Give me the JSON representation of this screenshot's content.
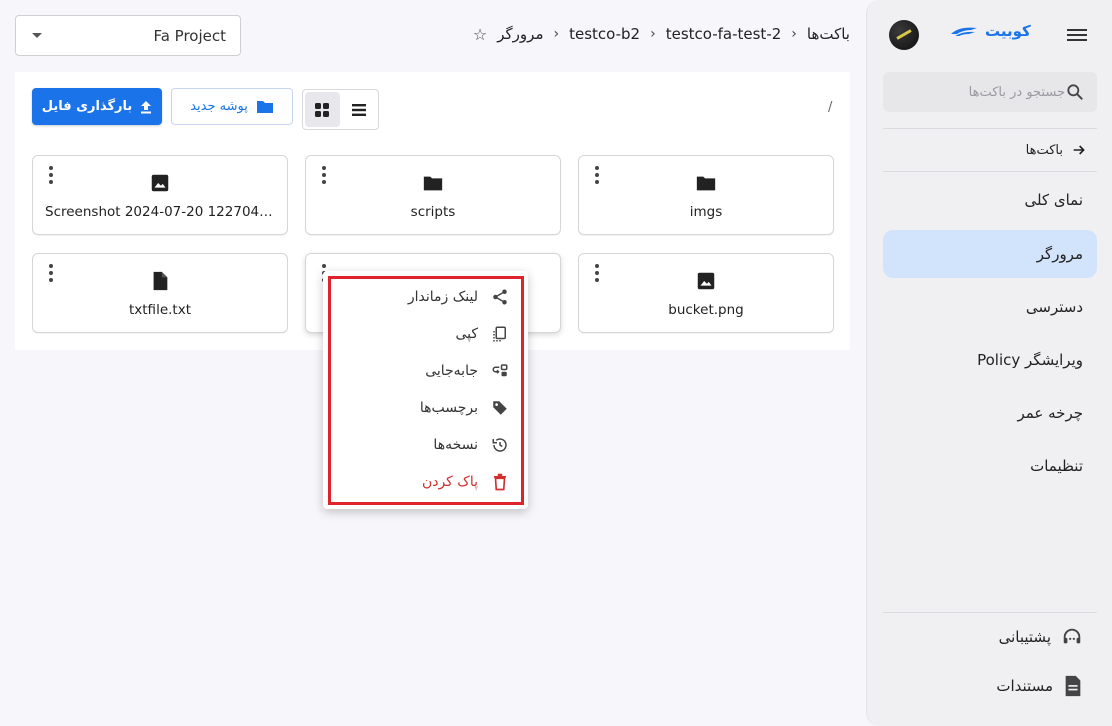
{
  "sidebar": {
    "brand": "کوبیت",
    "search_placeholder": "جستجو در باکت‌ها",
    "back_label": "باکت‌ها",
    "items": [
      {
        "label": "نمای کلی"
      },
      {
        "label": "مرورگر",
        "active": true
      },
      {
        "label": "دسترسی"
      },
      {
        "label": "ویرایشگر Policy"
      },
      {
        "label": "چرخه عمر"
      },
      {
        "label": "تنظیمات"
      }
    ],
    "support_label": "پشتیبانی",
    "docs_label": "مستندات"
  },
  "project_select": {
    "value": "Fa Project"
  },
  "breadcrumb": {
    "root": "باکت‌ها",
    "items": [
      "testco-fa-test-2",
      "testco-b2",
      "مرورگر"
    ]
  },
  "toolbar": {
    "path": "/",
    "new_folder_label": "پوشه جدید",
    "upload_label": "بارگذاری فایل"
  },
  "files": [
    {
      "name": "imgs",
      "type": "folder-icon"
    },
    {
      "name": "scripts",
      "type": "folder-icon"
    },
    {
      "name": "Screenshot 2024-07-20 122704....",
      "type": "image-icon"
    },
    {
      "name": "bucket.png",
      "type": "image-icon"
    },
    {
      "name": "",
      "type": "file-icon"
    },
    {
      "name": "txtfile.txt",
      "type": "file-icon"
    }
  ],
  "context_menu": {
    "items": [
      {
        "label": "لینک زماندار",
        "icon": "share-icon"
      },
      {
        "label": "کپی",
        "icon": "copy-icon"
      },
      {
        "label": "جابه‌جایی",
        "icon": "move-icon"
      },
      {
        "label": "برچسب‌ها",
        "icon": "tag-icon"
      },
      {
        "label": "نسخه‌ها",
        "icon": "history-icon"
      },
      {
        "label": "پاک کردن",
        "icon": "delete-icon",
        "danger": true
      }
    ]
  },
  "colors": {
    "accent": "#1a73e8",
    "active_nav": "#d2e3fc",
    "danger": "#d32f2f",
    "highlight": "#e0232b"
  }
}
